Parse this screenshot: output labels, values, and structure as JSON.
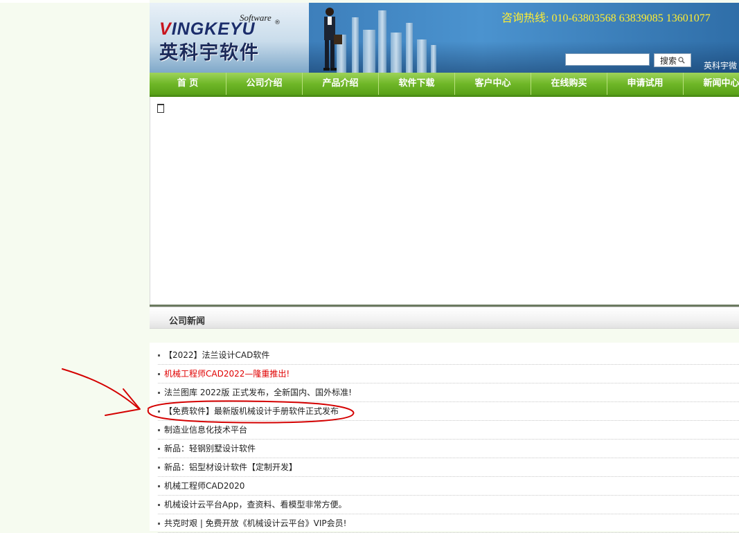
{
  "header": {
    "logo_software": "Software",
    "logo_en_v": "V",
    "logo_en_rest": "INGKEYU",
    "logo_reg": "®",
    "logo_cn": "英科宇软件",
    "hotline": "咨询热线: 010-63803568   63839085  13601077",
    "search_button": "搜索",
    "weixin": "英科宇微"
  },
  "nav": {
    "items": [
      "首 页",
      "公司介绍",
      "产品介绍",
      "软件下载",
      "客户中心",
      "在线购买",
      "申请试用",
      "新闻中心"
    ]
  },
  "news": {
    "title": "公司新闻",
    "items": [
      {
        "text": "【2022】法兰设计CAD软件",
        "highlight": false
      },
      {
        "text": "机械工程师CAD2022—隆重推出!",
        "highlight": true
      },
      {
        "text": "法兰图库 2022版 正式发布，全新国内、国外标准!",
        "highlight": false
      },
      {
        "text": "【免费软件】最新版机械设计手册软件正式发布",
        "highlight": false
      },
      {
        "text": "制造业信息化技术平台",
        "highlight": false
      },
      {
        "text": "新品：轻钢别墅设计软件",
        "highlight": false
      },
      {
        "text": "新品：铝型材设计软件【定制开发】",
        "highlight": false
      },
      {
        "text": "机械工程师CAD2020",
        "highlight": false
      },
      {
        "text": "机械设计云平台App，查资料、看模型非常方便。",
        "highlight": false
      },
      {
        "text": "共克时艰 | 免费开放《机械设计云平台》VIP会员!",
        "highlight": false
      }
    ]
  },
  "colors": {
    "nav_green": "#6fb728",
    "highlight_red": "#e00000",
    "hotline_yellow": "#ffee33",
    "annotation_red": "#d40000"
  }
}
